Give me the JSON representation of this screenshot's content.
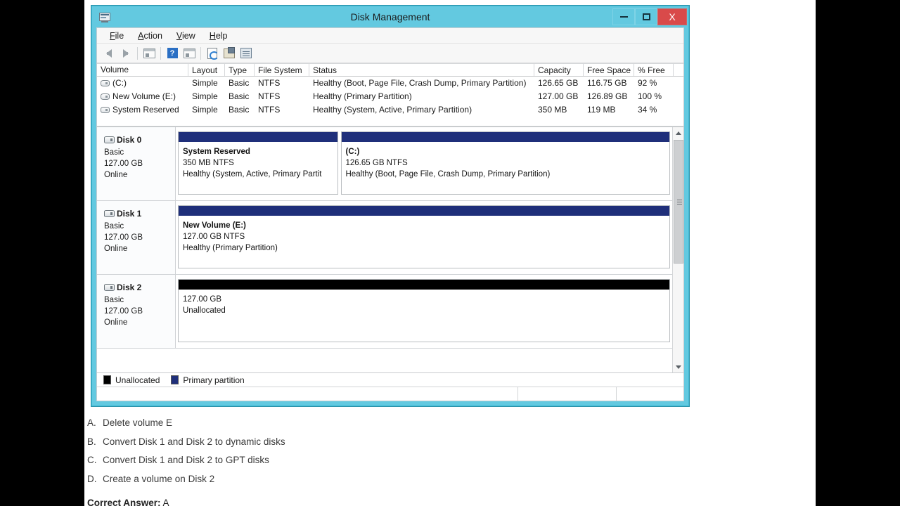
{
  "window": {
    "title": "Disk Management",
    "icon": "disk-management-icon",
    "minimize_label": "–",
    "maximize_label": "□",
    "close_label": "X",
    "accent_titlebar": "#63c9e0",
    "close_color": "#d94a4a"
  },
  "menu": [
    {
      "label": "File",
      "accel": "F"
    },
    {
      "label": "Action",
      "accel": "A"
    },
    {
      "label": "View",
      "accel": "V"
    },
    {
      "label": "Help",
      "accel": "H"
    }
  ],
  "toolbar": {
    "items": [
      {
        "name": "back-icon",
        "label": "Back"
      },
      {
        "name": "forward-icon",
        "label": "Forward"
      },
      {
        "name": "show-hide-console-tree-icon",
        "label": "Show/Hide Console Tree"
      },
      {
        "name": "help-icon",
        "label": "?"
      },
      {
        "name": "show-hide-action-pane-icon",
        "label": "Show/Hide Action Pane"
      },
      {
        "name": "refresh-icon",
        "label": "Refresh"
      },
      {
        "name": "properties-icon",
        "label": "Properties"
      },
      {
        "name": "rescan-disks-icon",
        "label": "Rescan Disks"
      }
    ]
  },
  "volume_list": {
    "headers": [
      "Volume",
      "Layout",
      "Type",
      "File System",
      "Status",
      "Capacity",
      "Free Space",
      "% Free"
    ],
    "rows": [
      {
        "volume": "(C:)",
        "layout": "Simple",
        "type": "Basic",
        "file_system": "NTFS",
        "status": "Healthy (Boot, Page File, Crash Dump, Primary Partition)",
        "capacity": "126.65 GB",
        "free_space": "116.75 GB",
        "percent_free": "92 %"
      },
      {
        "volume": "New Volume (E:)",
        "layout": "Simple",
        "type": "Basic",
        "file_system": "NTFS",
        "status": "Healthy (Primary Partition)",
        "capacity": "127.00 GB",
        "free_space": "126.89 GB",
        "percent_free": "100 %"
      },
      {
        "volume": "System Reserved",
        "layout": "Simple",
        "type": "Basic",
        "file_system": "NTFS",
        "status": "Healthy (System, Active, Primary Partition)",
        "capacity": "350 MB",
        "free_space": "119 MB",
        "percent_free": "34 %"
      }
    ]
  },
  "disks": [
    {
      "name": "Disk 0",
      "type": "Basic",
      "size": "127.00 GB",
      "state": "Online",
      "partitions": [
        {
          "name": "System Reserved",
          "size_fs": "350 MB NTFS",
          "status": "Healthy (System, Active, Primary Partit",
          "kind": "primary",
          "width_pct": 33
        },
        {
          "name": "(C:)",
          "size_fs": "126.65 GB NTFS",
          "status": "Healthy (Boot, Page File, Crash Dump, Primary Partition)",
          "kind": "primary",
          "width_pct": 67
        }
      ]
    },
    {
      "name": "Disk 1",
      "type": "Basic",
      "size": "127.00 GB",
      "state": "Online",
      "partitions": [
        {
          "name": "New Volume  (E:)",
          "size_fs": "127.00 GB NTFS",
          "status": "Healthy (Primary Partition)",
          "kind": "primary",
          "width_pct": 100
        }
      ]
    },
    {
      "name": "Disk 2",
      "type": "Basic",
      "size": "127.00 GB",
      "state": "Online",
      "partitions": [
        {
          "name": "",
          "size_fs": "127.00 GB",
          "status": "Unallocated",
          "kind": "unallocated",
          "width_pct": 100
        }
      ]
    }
  ],
  "legend": [
    {
      "label": "Unallocated",
      "color": "#000000"
    },
    {
      "label": "Primary partition",
      "color": "#1f2f7a"
    }
  ],
  "statusbar": {
    "pane1": "",
    "pane2": "",
    "pane3": ""
  },
  "quiz": {
    "choices": [
      {
        "letter": "A.",
        "text": "Delete volume E"
      },
      {
        "letter": "B.",
        "text": "Convert Disk 1 and Disk 2 to dynamic disks"
      },
      {
        "letter": "C.",
        "text": "Convert Disk 1 and Disk 2 to GPT disks"
      },
      {
        "letter": "D.",
        "text": "Create a volume on Disk 2"
      }
    ],
    "answer_label": "Correct Answer:",
    "answer_value": "A"
  }
}
